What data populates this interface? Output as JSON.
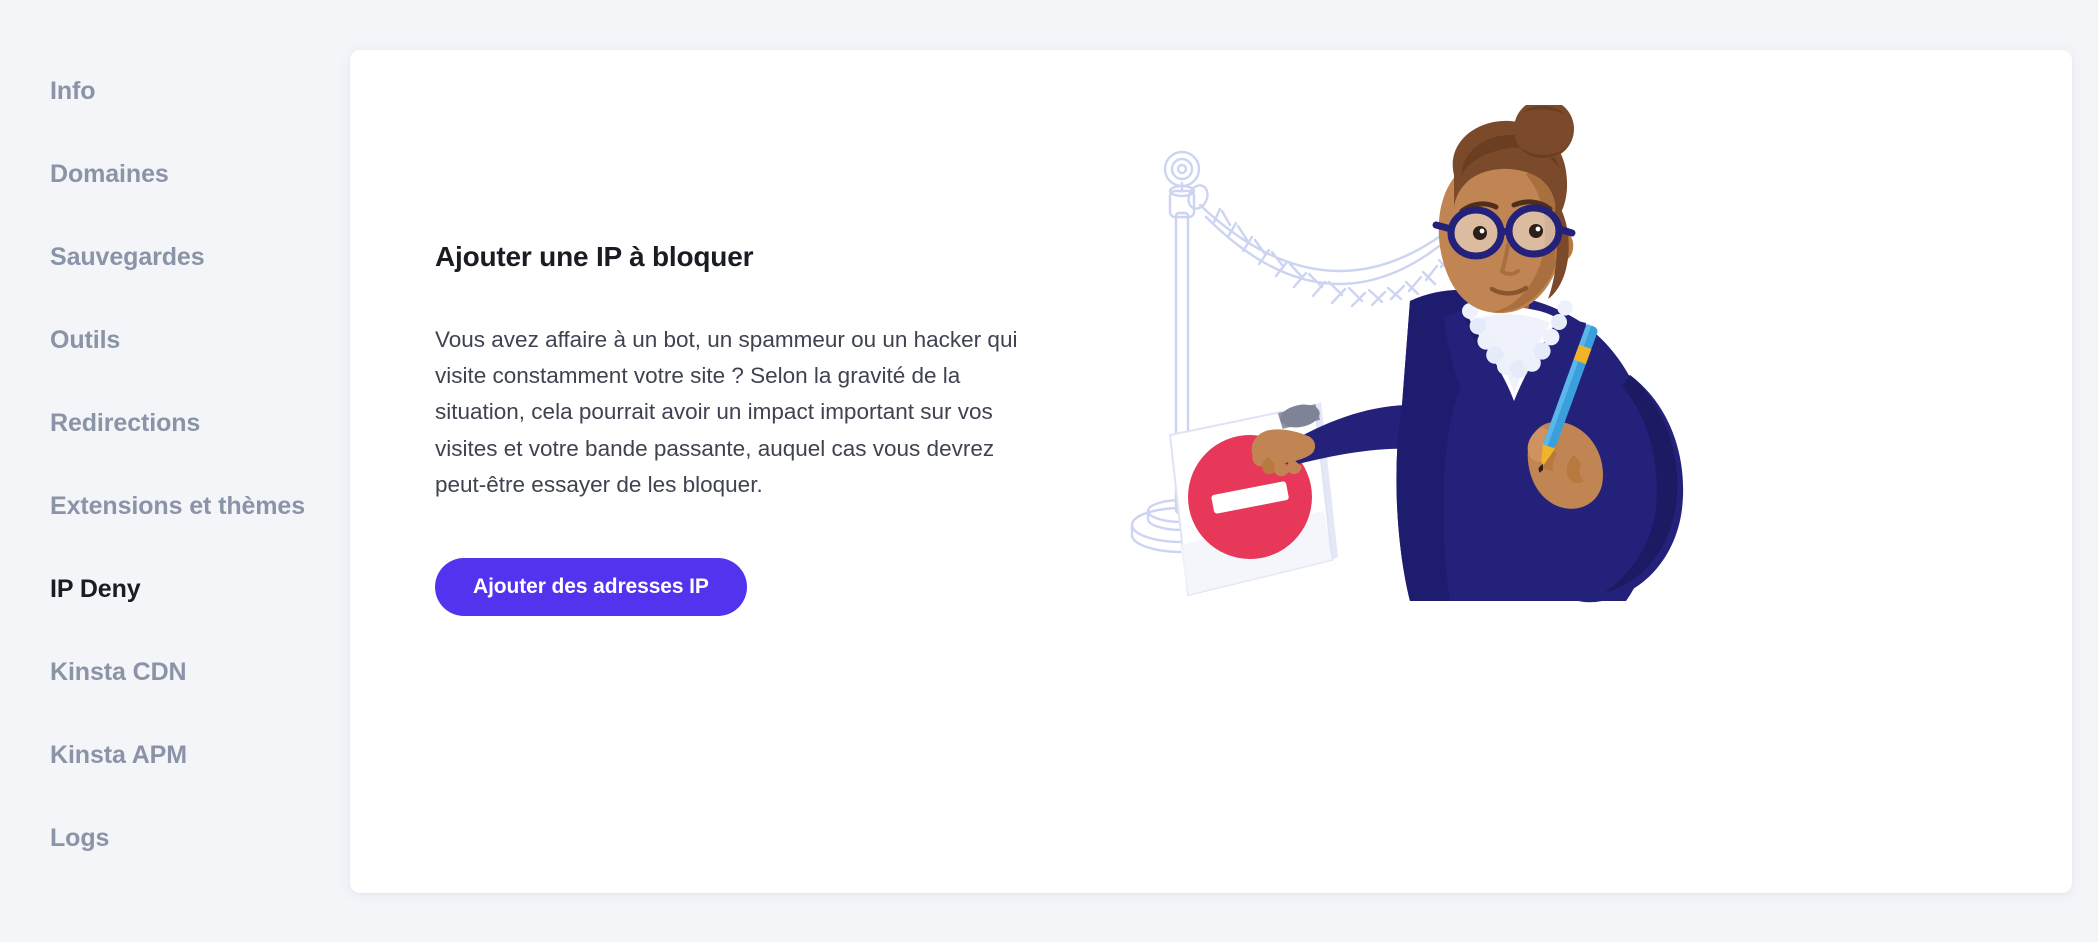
{
  "sidebar": {
    "items": [
      {
        "label": "Info",
        "active": false
      },
      {
        "label": "Domaines",
        "active": false
      },
      {
        "label": "Sauvegardes",
        "active": false
      },
      {
        "label": "Outils",
        "active": false
      },
      {
        "label": "Redirections",
        "active": false
      },
      {
        "label": "Extensions et thèmes",
        "active": false
      },
      {
        "label": "IP Deny",
        "active": true
      },
      {
        "label": "Kinsta CDN",
        "active": false
      },
      {
        "label": "Kinsta APM",
        "active": false
      },
      {
        "label": "Logs",
        "active": false
      }
    ]
  },
  "main": {
    "headline": "Ajouter une IP à bloquer",
    "body": "Vous avez affaire à un bot, un spammeur ou un hacker qui visite constamment votre site ? Selon la gravité de la situation, cela pourrait avoir un impact important sur vos visites et votre bande passante, auquel cas vous devrez peut-être essayer de les bloquer.",
    "cta_label": "Ajouter des adresses IP",
    "illustration_name": "woman-with-no-entry-clipboard-behind-velvet-rope"
  },
  "colors": {
    "accent_purple": "#5333ed",
    "page_background": "#f4f5f9",
    "card_background": "#ffffff",
    "nav_inactive_text": "#8b93a7",
    "nav_active_text": "#1a1c23",
    "body_text": "#3f4350",
    "illustration_navy": "#23217a",
    "illustration_navy_dark": "#1b1a63",
    "illustration_red": "#e8385a",
    "illustration_skin": "#c08552",
    "illustration_skin_dark": "#a26a3c",
    "illustration_hair": "#7a4a2a",
    "illustration_rope_outline": "#ccd4f2",
    "illustration_pen_blue": "#3aa0dd",
    "illustration_pearl": "#eef1fb"
  }
}
